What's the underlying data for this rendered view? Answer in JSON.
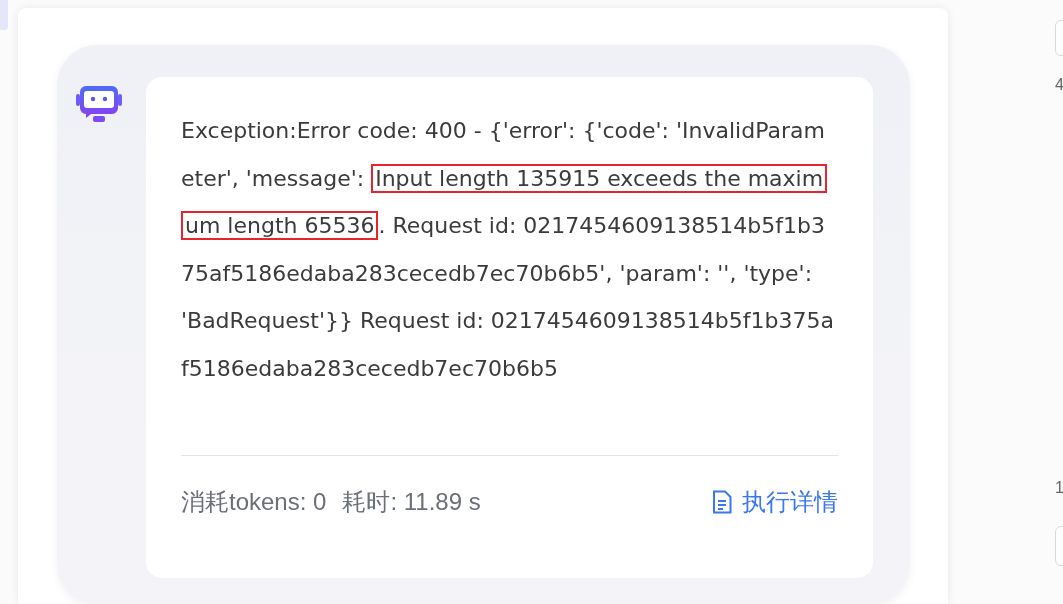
{
  "message": {
    "segments": [
      {
        "text": "Exception:Error code: 400 - {'error': {'code': 'InvalidParameter', 'message': ",
        "highlighted": false
      },
      {
        "text": "Input length 135915 exceeds the maximum length 65536",
        "highlighted": true
      },
      {
        "text": ". Request id: 0217454609138514b5f1b375af5186edaba283cecedb7ec70b6b5', 'param': '', 'type': 'BadRequest'}} Request id: 0217454609138514b5f1b375af5186edaba283cecedb7ec70b6b5",
        "highlighted": false
      }
    ]
  },
  "footer": {
    "tokens": "消耗tokens: 0",
    "duration": "耗时: 11.89 s",
    "details_link": "执行详情"
  },
  "right_edge": {
    "column_1": "4",
    "column_2": "1"
  }
}
